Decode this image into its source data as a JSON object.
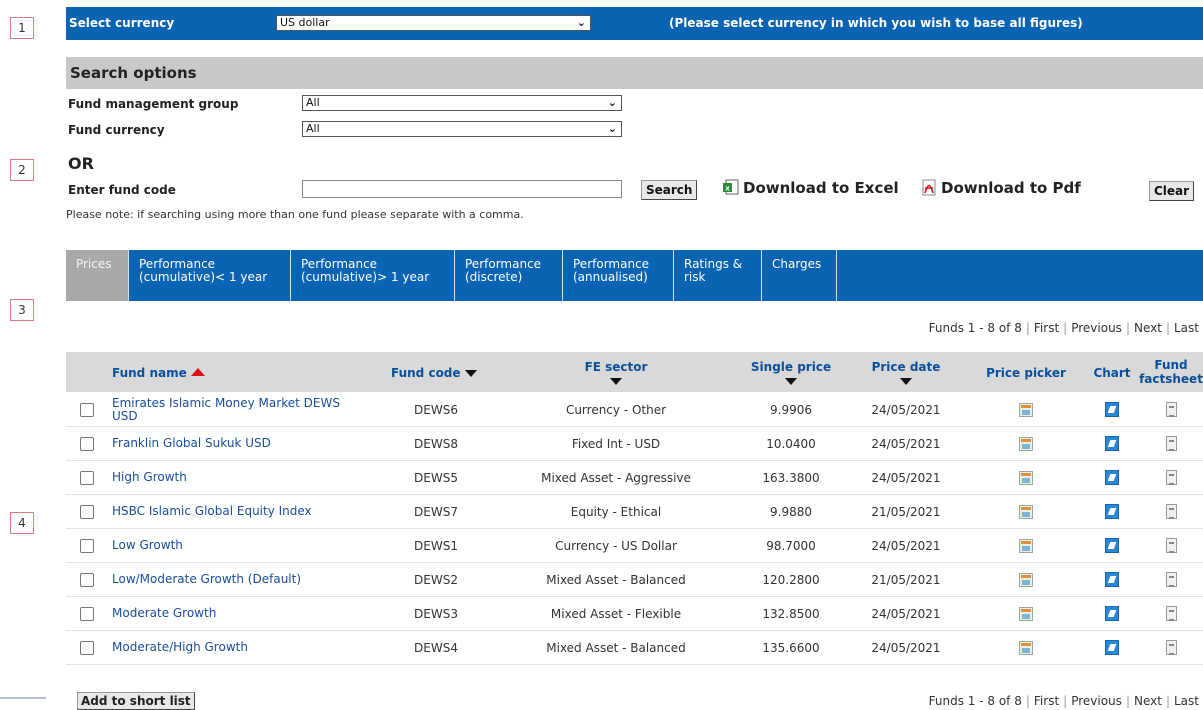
{
  "markers": [
    "1",
    "2",
    "3",
    "4"
  ],
  "currency_bar": {
    "label": "Select currency",
    "selected": "US dollar",
    "note": "(Please select currency in which you wish to base all figures)"
  },
  "search": {
    "heading": "Search options",
    "group_label": "Fund management group",
    "group_value": "All",
    "currency_label": "Fund currency",
    "currency_value": "All",
    "or_label": "OR",
    "code_label": "Enter fund code",
    "code_value": "",
    "search_button": "Search",
    "download_excel": "Download to Excel",
    "download_pdf": "Download to Pdf",
    "clear_button": "Clear",
    "note": "Please note: if searching using more than one fund please separate with a comma."
  },
  "tabs": [
    {
      "line1": "Prices",
      "line2": ""
    },
    {
      "line1": "Performance",
      "line2": "(cumulative)< 1 year"
    },
    {
      "line1": "Performance",
      "line2": "(cumulative)> 1 year"
    },
    {
      "line1": "Performance",
      "line2": "(discrete)"
    },
    {
      "line1": "Performance",
      "line2": "(annualised)"
    },
    {
      "line1": "Ratings &",
      "line2": "risk"
    },
    {
      "line1": "Charges",
      "line2": ""
    }
  ],
  "pager": {
    "range": "Funds 1 - 8 of 8",
    "first": "First",
    "previous": "Previous",
    "next": "Next",
    "last": "Last"
  },
  "columns": {
    "fund_name": "Fund name",
    "fund_code": "Fund code",
    "fe_sector": "FE sector",
    "single_price": "Single price",
    "price_date": "Price date",
    "price_picker": "Price picker",
    "chart": "Chart",
    "factsheet_1": "Fund",
    "factsheet_2": "factsheet"
  },
  "rows": [
    {
      "name1": "Emirates Islamic Money Market DEWS",
      "name2": "USD",
      "code": "DEWS6",
      "sector": "Currency - Other",
      "price": "9.9906",
      "date": "24/05/2021"
    },
    {
      "name1": "Franklin Global Sukuk USD",
      "name2": "",
      "code": "DEWS8",
      "sector": "Fixed Int - USD",
      "price": "10.0400",
      "date": "24/05/2021"
    },
    {
      "name1": "High Growth",
      "name2": "",
      "code": "DEWS5",
      "sector": "Mixed Asset - Aggressive",
      "price": "163.3800",
      "date": "24/05/2021"
    },
    {
      "name1": "HSBC Islamic Global Equity Index",
      "name2": "",
      "code": "DEWS7",
      "sector": "Equity - Ethical",
      "price": "9.9880",
      "date": "21/05/2021"
    },
    {
      "name1": "Low Growth",
      "name2": "",
      "code": "DEWS1",
      "sector": "Currency - US Dollar",
      "price": "98.7000",
      "date": "24/05/2021"
    },
    {
      "name1": "Low/Moderate Growth (Default)",
      "name2": "",
      "code": "DEWS2",
      "sector": "Mixed Asset - Balanced",
      "price": "120.2800",
      "date": "21/05/2021"
    },
    {
      "name1": "Moderate Growth",
      "name2": "",
      "code": "DEWS3",
      "sector": "Mixed Asset - Flexible",
      "price": "132.8500",
      "date": "24/05/2021"
    },
    {
      "name1": "Moderate/High Growth",
      "name2": "",
      "code": "DEWS4",
      "sector": "Mixed Asset - Balanced",
      "price": "135.6600",
      "date": "24/05/2021"
    }
  ],
  "add_button": "Add to short list",
  "icons": {
    "price_picker": "price-picker-icon",
    "chart": "chart-icon",
    "factsheet": "factsheet-icon",
    "excel": "excel-icon",
    "pdf": "pdf-icon"
  },
  "colors": {
    "brand_blue": "#0a63b3",
    "header_grey": "#c9c9c9",
    "link_blue": "#1a4f9a",
    "sort_red": "#e0101a"
  }
}
